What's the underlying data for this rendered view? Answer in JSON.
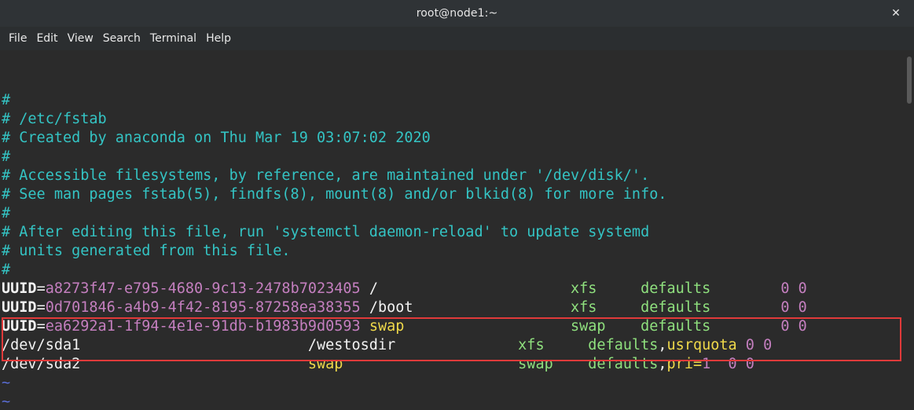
{
  "window": {
    "title": "root@node1:~",
    "close_glyph": "✕"
  },
  "menubar": {
    "items": [
      "File",
      "Edit",
      "View",
      "Search",
      "Terminal",
      "Help"
    ]
  },
  "comments": [
    "#",
    "# /etc/fstab",
    "# Created by anaconda on Thu Mar 19 03:07:02 2020",
    "#",
    "# Accessible filesystems, by reference, are maintained under '/dev/disk/'.",
    "# See man pages fstab(5), findfs(8), mount(8) and/or blkid(8) for more info.",
    "#",
    "# After editing this file, run 'systemctl daemon-reload' to update systemd",
    "# units generated from this file.",
    "#"
  ],
  "entries": [
    {
      "key": "UUID",
      "eq": "=",
      "uuid": "a8273f47-e795-4680-9c13-2478b7023405",
      "pad1": " ",
      "mount": "/",
      "pad2": "                      ",
      "type": "xfs",
      "pad3": "     ",
      "opts": "defaults",
      "extra": "",
      "pad4": "        ",
      "nums": "0 0"
    },
    {
      "key": "UUID",
      "eq": "=",
      "uuid": "0d701846-a4b9-4f42-8195-87258ea38355",
      "pad1": " ",
      "mount": "/boot",
      "pad2": "                  ",
      "type": "xfs",
      "pad3": "     ",
      "opts": "defaults",
      "extra": "",
      "pad4": "        ",
      "nums": "0 0"
    },
    {
      "key": "UUID",
      "eq": "=",
      "uuid": "ea6292a1-1f94-4e1e-91db-b1983b9d0593",
      "pad1": " ",
      "mount": "swap",
      "pad2": "                   ",
      "type": "swap",
      "pad3": "    ",
      "opts": "defaults",
      "extra": "",
      "pad4": "        ",
      "nums": "0 0"
    }
  ],
  "dev_entries": [
    {
      "dev": "/dev/sda1",
      "pad1": "                          ",
      "mount": "/westosdir",
      "pad2": "              ",
      "type": "xfs",
      "pad3": "     ",
      "opts": "defaults",
      "comma": ",",
      "opt2": "usrquota",
      "pad4": " ",
      "nums": "0 0"
    },
    {
      "dev": "/dev/sda2",
      "pad1": "                          ",
      "mount": "swap",
      "pad2": "                    ",
      "type": "swap",
      "pad3": "    ",
      "opts": "defaults",
      "comma": ",",
      "opt2": "pri=",
      "val": "1",
      "pad4": "  ",
      "nums": "0 0"
    }
  ],
  "tildes": [
    "~",
    "~",
    "~"
  ],
  "colors": {
    "comment": "#34c4c4",
    "uuid": "#c47fbf",
    "swap": "#f0d94a",
    "options": "#8fe07e",
    "highlight": "#e03a3a"
  }
}
